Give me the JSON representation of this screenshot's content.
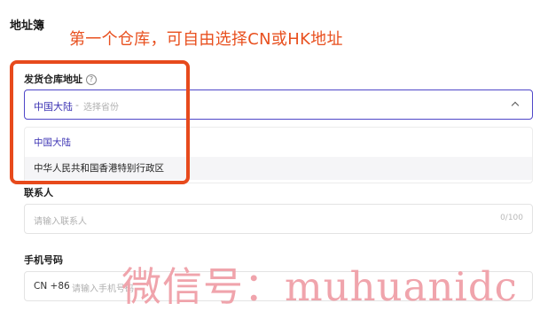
{
  "header": {
    "title": "地址簿",
    "annotation": "第一个仓库，可自由选择CN或HK地址"
  },
  "warehouse": {
    "label": "发货仓库地址",
    "help_icon": "?",
    "selected": "中国大陆",
    "separator": "-",
    "placeholder": "选择省份",
    "options": [
      "中国大陆",
      "中华人民共和国香港特别行政区"
    ]
  },
  "contact": {
    "label": "联系人",
    "placeholder": "请输入联系人",
    "counter": "0/100"
  },
  "phone": {
    "label": "手机号码",
    "prefix": "CN +86",
    "placeholder": "请输入手机号码"
  },
  "watermark": "微信号：muhuanidc",
  "colors": {
    "accent": "#3b32b3",
    "annotation": "#e8501f",
    "highlight": "#e74a1c",
    "watermark": "#f0a0a8"
  },
  "icons": {
    "help": "help-icon",
    "dropdown": "chevron-up-icon"
  }
}
